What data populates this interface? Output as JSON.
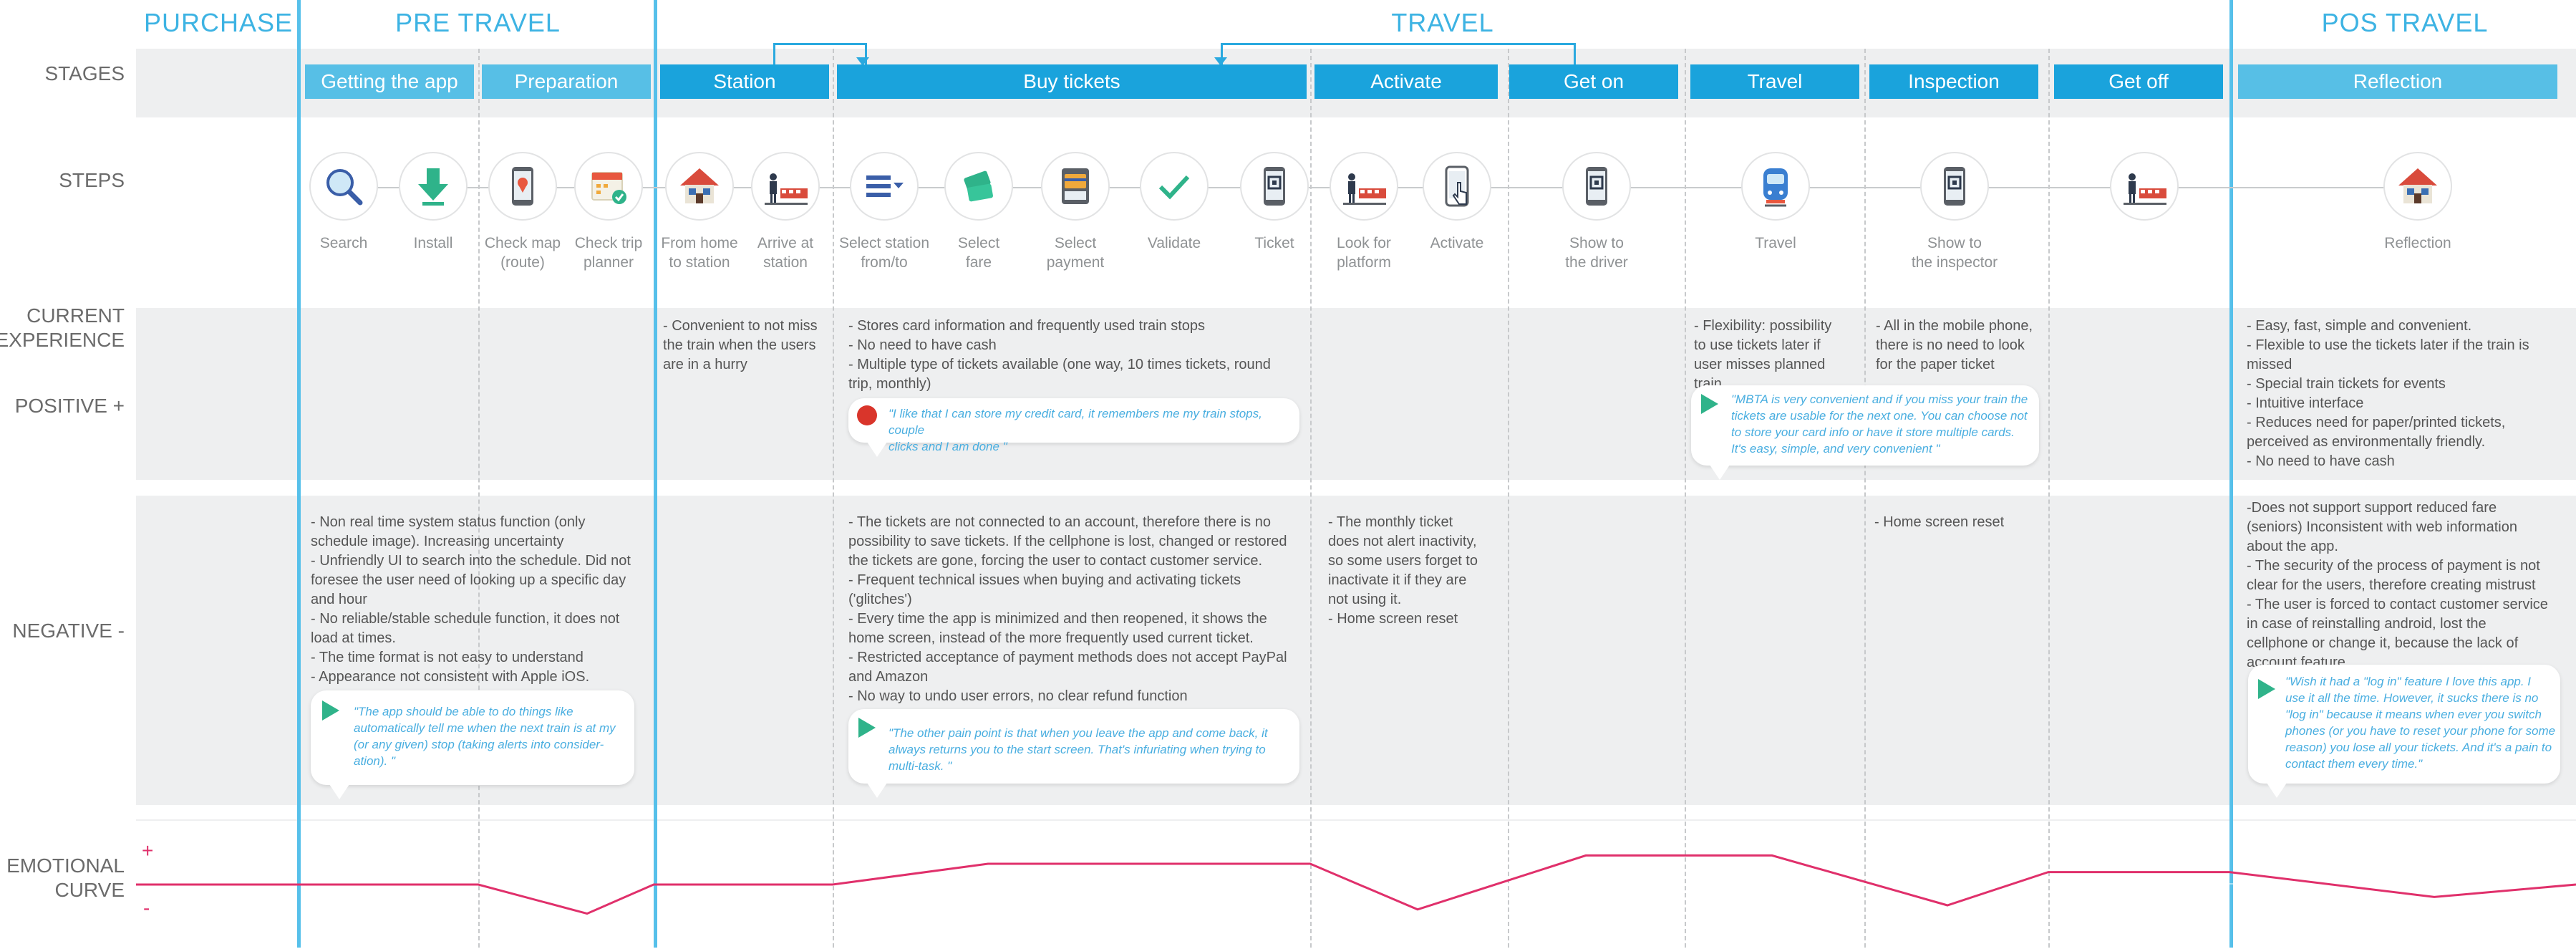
{
  "phases": {
    "purchase": "PURCHASE",
    "pre_travel": "PRE TRAVEL",
    "travel": "TRAVEL",
    "pos_travel": "POS TRAVEL"
  },
  "row_labels": {
    "stages": "STAGES",
    "steps": "STEPS",
    "current_experience": "CURRENT\nEXPERIENCE",
    "positive": "POSITIVE +",
    "negative": "NEGATIVE -",
    "emotional_curve": "EMOTIONAL\nCURVE",
    "curve_plus": "+",
    "curve_minus": "-"
  },
  "stages": [
    "Getting the app",
    "Preparation",
    "Station",
    "Buy tickets",
    "Activate",
    "Get on",
    "Travel",
    "Inspection",
    "Get off",
    "Reflection"
  ],
  "steps": [
    {
      "label": "Search",
      "icon": "magnifier-icon"
    },
    {
      "label": "Install",
      "icon": "download-arrow-icon"
    },
    {
      "label": "Check map\n(route)",
      "icon": "phone-map-pin-icon"
    },
    {
      "label": "Check trip\nplanner",
      "icon": "calendar-check-icon"
    },
    {
      "label": "From home\nto station",
      "icon": "house-icon"
    },
    {
      "label": "Arrive at\nstation",
      "icon": "person-train-icon"
    },
    {
      "label": "Select station\nfrom/to",
      "icon": "list-dropdown-icon"
    },
    {
      "label": "Select\nfare",
      "icon": "tickets-icon"
    },
    {
      "label": "Select\npayment",
      "icon": "payment-card-icon"
    },
    {
      "label": "Validate",
      "icon": "checkmark-icon"
    },
    {
      "label": "Ticket",
      "icon": "phone-qr-icon"
    },
    {
      "label": "Look for\nplatform",
      "icon": "person-train-icon"
    },
    {
      "label": "Activate",
      "icon": "phone-touch-icon"
    },
    {
      "label": "Show to\nthe driver",
      "icon": "phone-qr-icon"
    },
    {
      "label": "Travel",
      "icon": "train-front-icon"
    },
    {
      "label": "Show to\nthe inspector",
      "icon": "phone-qr-icon"
    },
    {
      "label": "",
      "icon": "person-train-icon"
    },
    {
      "label": "Reflection",
      "icon": "house-icon"
    }
  ],
  "positive": {
    "station": "- Convenient to not miss\nthe train when the users\nare in a hurry",
    "buy_tickets": "- Stores card information and frequently used train stops\n- No need to have cash\n- Multiple type of tickets available (one way, 10 times tickets, round\ntrip, monthly)",
    "buy_tickets_quote": "\"I like that I can store my credit card, it remembers me my train stops, couple\nclicks and I am done \"",
    "travel": "- Flexibility: possibility\nto use tickets later if\nuser misses planned\ntrain",
    "inspection": "- All in the mobile phone,\nthere is no need to look\nfor the paper ticket",
    "travel_quote": "\"MBTA is very convenient and if you miss your train the\ntickets are usable for the next one. You can choose not\nto store your card info or have it store multiple cards.\nIt's easy, simple, and very convenient \"",
    "reflection": "- Easy, fast, simple and convenient.\n- Flexible to use the tickets later if the train is\nmissed\n- Special train tickets for events\n- Intuitive interface\n- Reduces need for paper/printed tickets,\nperceived as environmentally friendly.\n- No need to have cash"
  },
  "negative": {
    "pre_travel": "- Non real time system status function (only\nschedule image). Increasing uncertainty\n- Unfriendly UI to search into the schedule. Did not\nforesee the user need of looking up a specific day\nand hour\n- No reliable/stable schedule function, it does not\nload at times.\n- The time format is not easy to understand\n- Appearance not consistent with Apple iOS.",
    "pre_travel_quote": "\"The app should be able to do things like\nautomatically tell me when the next train is at my\n(or any given) stop (taking alerts into consider-\nation). \"",
    "buy_tickets": "- The tickets are not connected to an account, therefore there is no\npossibility to save tickets. If the cellphone is lost, changed or restored\nthe tickets are gone, forcing the user to contact customer service.\n- Frequent technical issues when buying and activating tickets\n('glitches')\n- Every time the app is minimized and then reopened, it shows the\nhome screen, instead of the more frequently used current ticket.\n- Restricted acceptance of payment methods does not accept PayPal\nand Amazon\n- No way to undo user errors, no clear refund function",
    "buy_tickets_quote": "\"The other pain point is that when you leave the app and come back, it\nalways returns you to the start screen. That's infuriating when trying to\nmulti-task. \"",
    "activate": "- The monthly ticket\ndoes not alert  inactivity,\nso some users forget to\ninactivate it if they are\nnot using it.\n- Home screen reset",
    "inspection": "- Home screen reset",
    "reflection": "-Does not support support reduced fare\n(seniors) Inconsistent with web information\nabout the app.\n- The security of the process of payment is not\nclear for the users, therefore creating mistrust\n- The user is forced to contact customer service\nin case of reinstalling android, lost the\ncellphone or change it, because the lack of\naccount feature",
    "reflection_quote": "\"Wish it had a \"log in\" feature I love this app. I\nuse it all the time. However, it sucks there is no\n\"log in\" because it means when ever you switch\nphones (or you have to reset your phone for some\nreason) you lose all your tickets. And it's a pain to\ncontact them every time.\""
  },
  "emotional_curve": {
    "x": [
      0,
      1,
      2,
      3,
      4,
      5,
      6,
      7,
      8,
      9,
      10,
      11,
      12,
      13,
      14,
      15,
      16,
      17
    ],
    "values": [
      0,
      0,
      0,
      -0.7,
      0,
      0,
      0.5,
      0.5,
      0.5,
      -0.6,
      0.7,
      0.7,
      -0.5,
      0.3,
      0.3,
      -0.3,
      0
    ]
  },
  "colors": {
    "accent": "#1aa3dc",
    "stage_light": "#57bfe6",
    "phase_text": "#3db3e3",
    "curve": "#e0306b",
    "band": "#eeeff0"
  }
}
